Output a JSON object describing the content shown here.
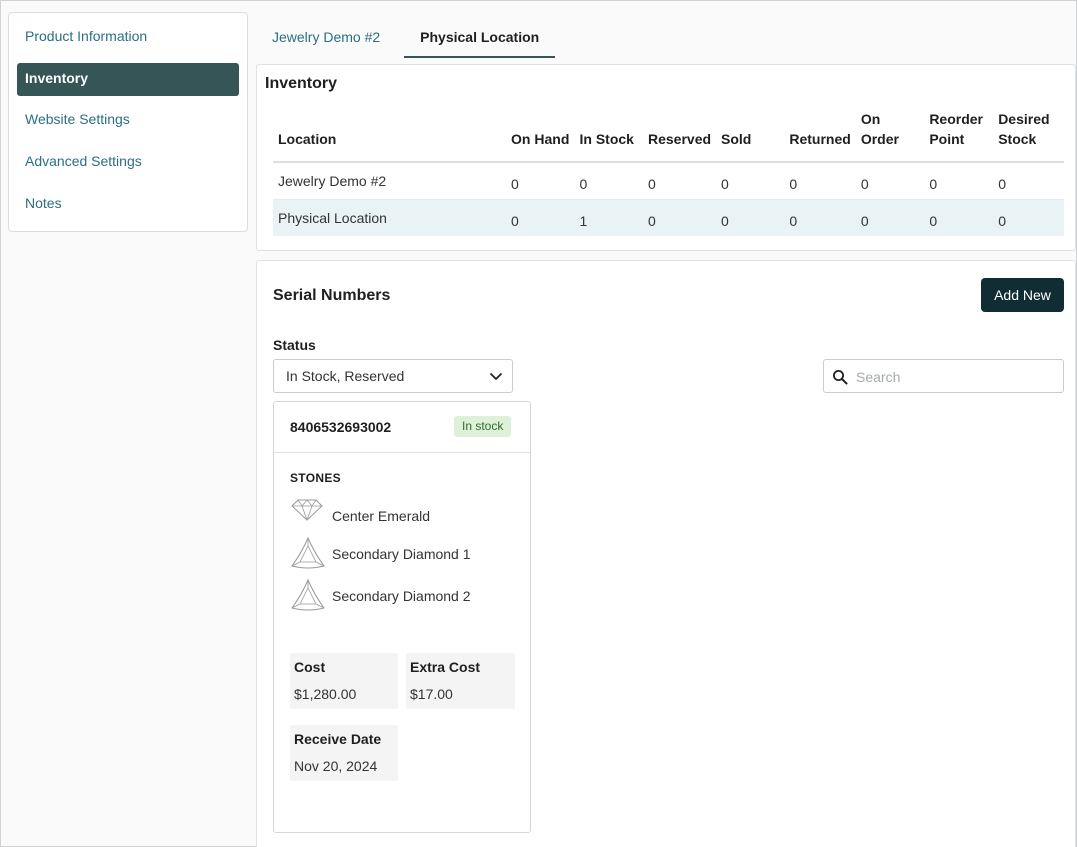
{
  "sidebar": {
    "items": [
      {
        "label": "Product Information"
      },
      {
        "label": "Inventory"
      },
      {
        "label": "Website Settings"
      },
      {
        "label": "Advanced Settings"
      },
      {
        "label": "Notes"
      }
    ],
    "active_index": 1
  },
  "tabs": [
    {
      "label": "Jewelry Demo #2"
    },
    {
      "label": "Physical Location"
    }
  ],
  "inventory": {
    "title": "Inventory",
    "columns": [
      "Location",
      "On Hand",
      "In Stock",
      "Reserved",
      "Sold",
      "Returned",
      "On Order",
      "Reorder Point",
      "Desired Stock"
    ],
    "rows": [
      {
        "location": "Jewelry Demo #2",
        "on_hand": "0",
        "in_stock": "0",
        "reserved": "0",
        "sold": "0",
        "returned": "0",
        "on_order": "0",
        "reorder_point": "0",
        "desired_stock": "0"
      },
      {
        "location": "Physical Location",
        "on_hand": "0",
        "in_stock": "1",
        "reserved": "0",
        "sold": "0",
        "returned": "0",
        "on_order": "0",
        "reorder_point": "0",
        "desired_stock": "0"
      }
    ]
  },
  "serial_numbers": {
    "title": "Serial Numbers",
    "add_button": "Add New",
    "status_label": "Status",
    "status_value": "In Stock, Reserved",
    "search_placeholder": "Search",
    "card": {
      "serial": "8406532693002",
      "badge": "In stock",
      "stones_label": "STONES",
      "stones": [
        {
          "name": "Center Emerald",
          "icon": "round-gem-icon"
        },
        {
          "name": "Secondary Diamond 1",
          "icon": "trillion-gem-icon"
        },
        {
          "name": "Secondary Diamond 2",
          "icon": "trillion-gem-icon"
        }
      ],
      "cost_label": "Cost",
      "cost_value": "$1,280.00",
      "extra_cost_label": "Extra Cost",
      "extra_cost_value": "$17.00",
      "receive_date_label": "Receive Date",
      "receive_date_value": "Nov 20, 2024"
    }
  },
  "colors": {
    "accent": "#355557",
    "link": "#2b6f82",
    "button": "#0f2d33",
    "badge_bg": "#dff0d8"
  }
}
